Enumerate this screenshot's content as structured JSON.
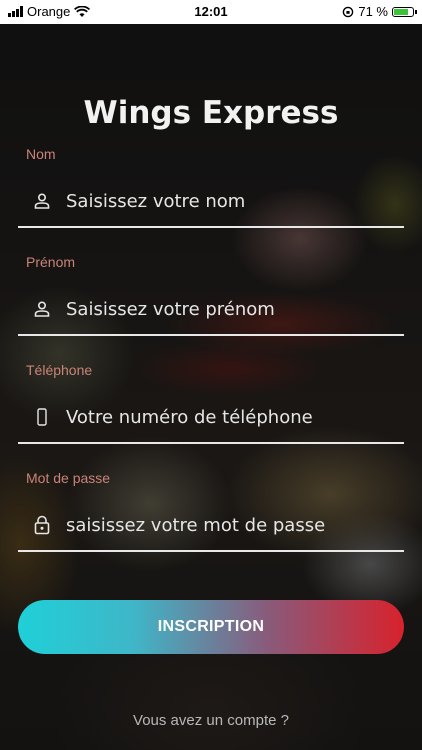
{
  "status_bar": {
    "carrier": "Orange",
    "time": "12:01",
    "battery_percent": "71 %",
    "battery_level": 0.71
  },
  "app": {
    "title": "Wings Express"
  },
  "form": {
    "nom": {
      "label": "Nom",
      "placeholder": "Saisissez votre nom",
      "value": "",
      "icon": "person-icon"
    },
    "prenom": {
      "label": "Prénom",
      "placeholder": "Saisissez votre prénom",
      "value": "",
      "icon": "person-icon"
    },
    "telephone": {
      "label": "Téléphone",
      "placeholder": "Votre numéro de téléphone",
      "value": "",
      "icon": "phone-icon"
    },
    "password": {
      "label": "Mot de passe",
      "placeholder": "saisissez votre mot de passe",
      "value": "",
      "icon": "lock-icon"
    }
  },
  "submit": {
    "label": "INSCRIPTION"
  },
  "footer": {
    "login_prompt": "Vous avez un compte ?"
  },
  "colors": {
    "label_color": "#c98478",
    "gradient_start": "#1fd0d8",
    "gradient_end": "#d8222c"
  }
}
